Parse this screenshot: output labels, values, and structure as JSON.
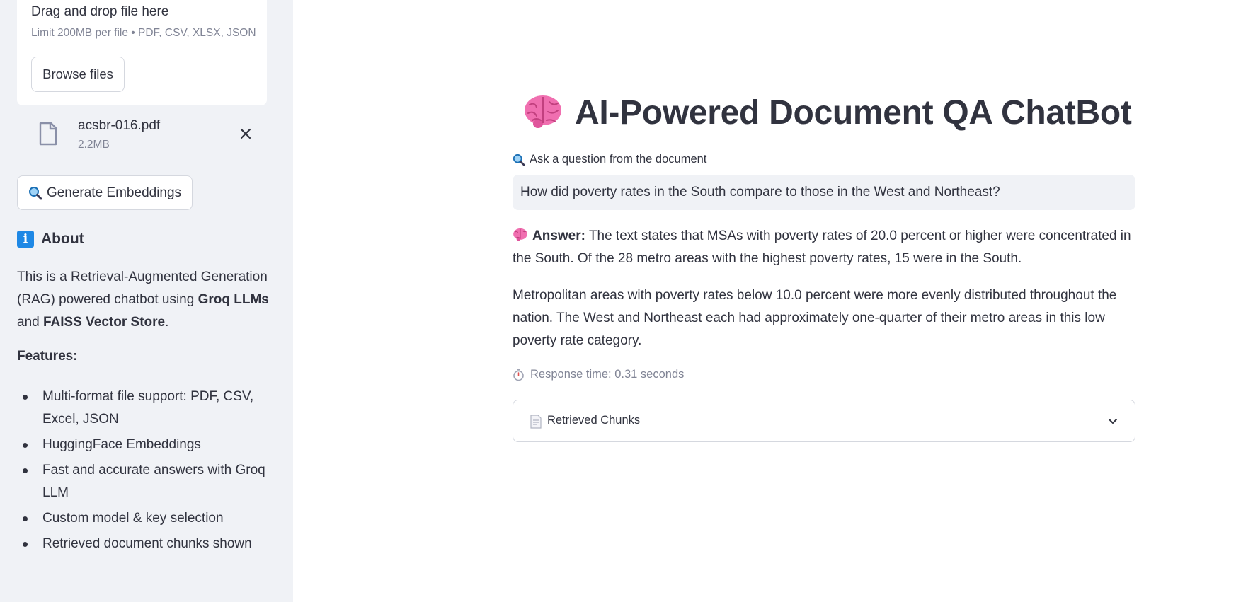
{
  "sidebar": {
    "uploader": {
      "drag_text": "Drag and drop file here",
      "limit_text": "Limit 200MB per file • PDF, CSV, XLSX, JSON",
      "browse_label": "Browse files"
    },
    "uploaded_file": {
      "name": "acsbr-016.pdf",
      "size": "2.2MB",
      "icon": "file-icon"
    },
    "generate_button": {
      "icon": "magnifier-icon",
      "label": "Generate Embeddings"
    },
    "about": {
      "icon": "info-icon",
      "title": "About",
      "text_prefix": "This is a Retrieval-Augmented Generation (RAG) powered chatbot using ",
      "bold_1": "Groq LLMs",
      "text_mid": " and ",
      "bold_2": "FAISS Vector Store",
      "text_suffix": ".",
      "features_label": "Features:",
      "features": [
        "Multi-format file support: PDF, CSV, Excel, JSON",
        "HuggingFace Embeddings",
        "Fast and accurate answers with Groq LLM",
        "Custom model & key selection",
        "Retrieved document chunks shown"
      ]
    }
  },
  "main": {
    "title_icon": "brain-icon",
    "title": "AI-Powered Document QA ChatBot",
    "question_label": "Ask a question from the document",
    "question_value": "How did poverty rates in the South compare to those in the West and Northeast?",
    "answer_label": "Answer:",
    "answer_p1": " The text states that MSAs with poverty rates of 20.0 percent or higher were concentrated in the South. Of the 28 metro areas with the highest poverty rates, 15 were in the South.",
    "answer_p2": "Metropolitan areas with poverty rates below 10.0 percent were more evenly distributed throughout the nation. The West and Northeast each had approximately one-quarter of their metro areas in this low poverty rate category.",
    "response_time": "Response time: 0.31 seconds",
    "expander_label": "Retrieved Chunks"
  },
  "colors": {
    "sidebar_bg": "#f0f2f6",
    "text": "#31333f",
    "muted": "#808495",
    "info_blue": "#1e88e5",
    "brain_pink": "#f06fb0"
  }
}
